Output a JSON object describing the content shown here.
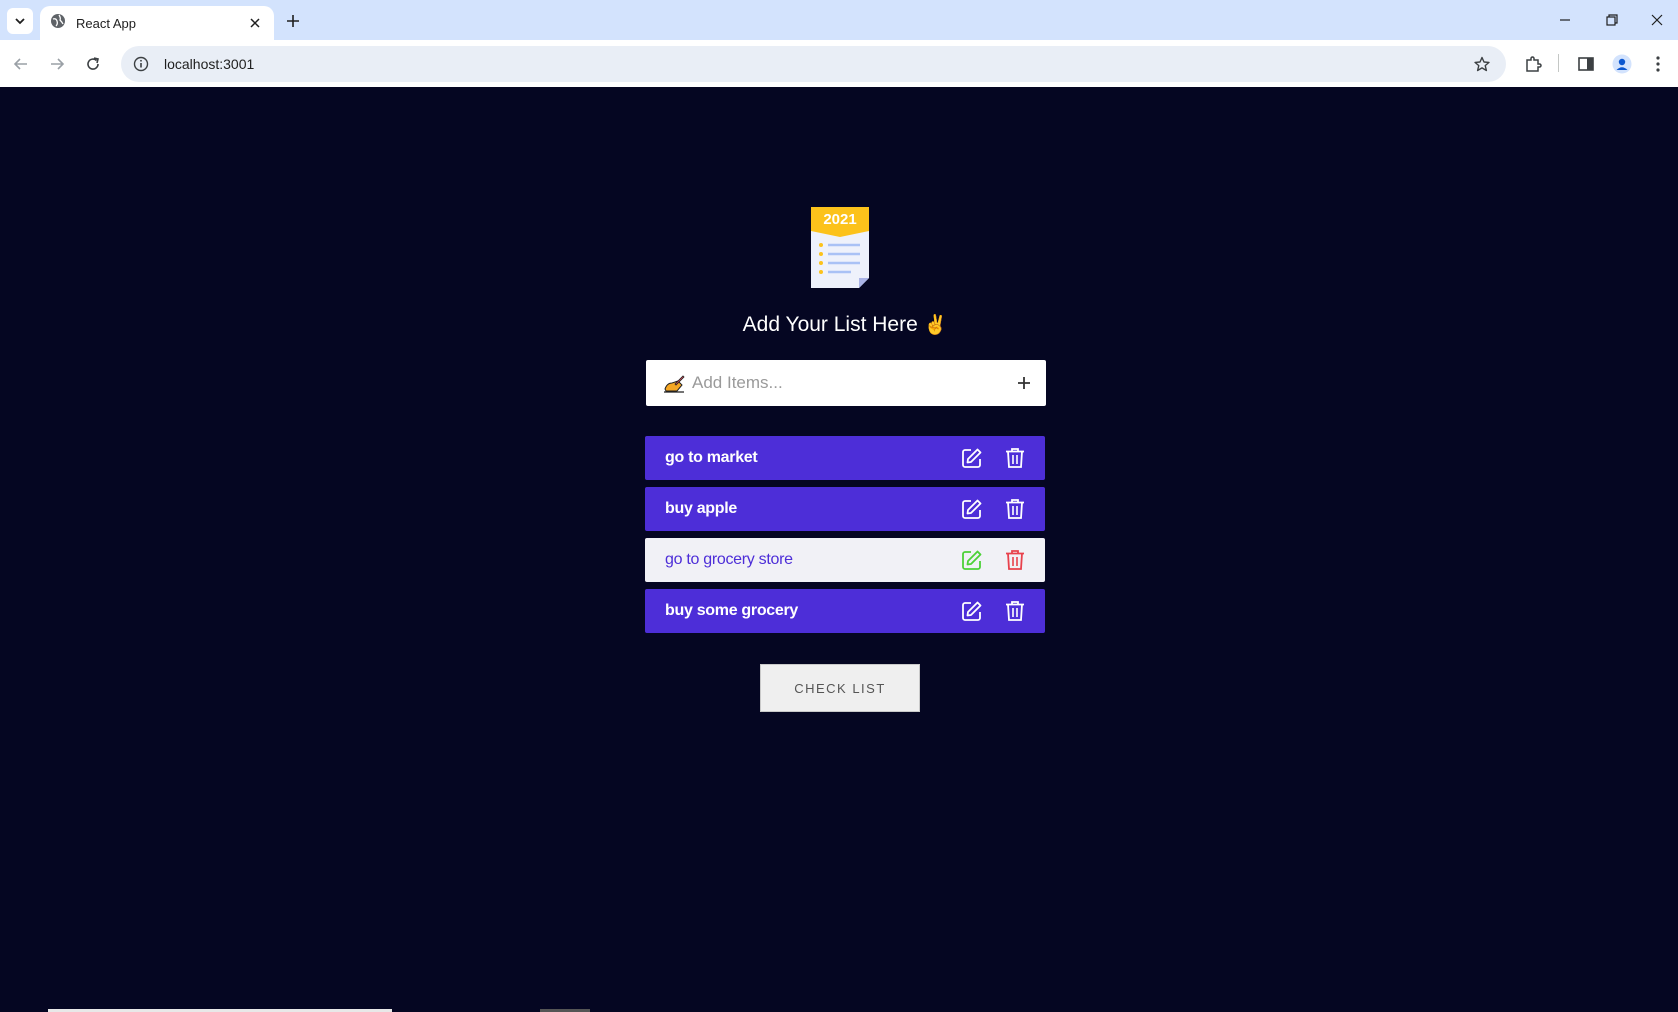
{
  "browser": {
    "tab_title": "React App",
    "url": "localhost:3001"
  },
  "app": {
    "logo_year": "2021",
    "heading": "Add Your List Here",
    "heading_emoji": "✌",
    "input_placeholder": "Add Items...",
    "input_emoji": "✍",
    "items": [
      {
        "text": "go to market",
        "style": "dark"
      },
      {
        "text": "buy apple",
        "style": "dark"
      },
      {
        "text": "go to grocery store",
        "style": "light"
      },
      {
        "text": "buy some grocery",
        "style": "dark"
      }
    ],
    "check_button": "CHECK LIST"
  },
  "colors": {
    "background": "#050622",
    "item_dark": "#4d2ed8",
    "item_light": "#f1f1f6",
    "edit_green": "#4cd137",
    "delete_red": "#e8414c"
  }
}
